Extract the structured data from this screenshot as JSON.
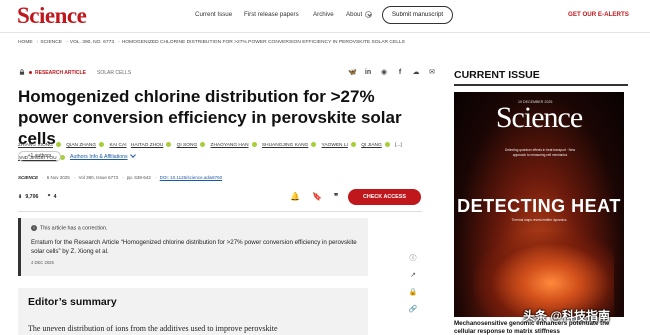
{
  "header": {
    "logo": "Science",
    "nav": [
      "Current Issue",
      "First release papers",
      "Archive",
      "About"
    ],
    "submit": "Submit manuscript",
    "alerts": "GET OUR E-ALERTS"
  },
  "breadcrumb": [
    "HOME",
    "SCIENCE",
    "VOL. 390, NO. 6773",
    "HOMOGENIZED CHLORINE DISTRIBUTION FOR >27% POWER CONVERSION EFFICIENCY IN PEROVSKITE SOLAR CELLS"
  ],
  "article": {
    "type": "RESEARCH ARTICLE",
    "subject": "SOLAR CELLS",
    "title": "Homogenized chlorine distribution for >27% power conversion efficiency in perovskite solar cells",
    "authors": [
      "ZHIANG XIONG",
      "QIAN ZHANG",
      "KAI CAI",
      "HAITAO ZHOU",
      "QI SONG",
      "ZHAOYANG HAN",
      "SHUANGJING KANG",
      "YAOWEN LI",
      "QI JIANG",
      "[...]",
      "AND JINGBI YOU"
    ],
    "more_authors": "+1 authors",
    "affiliations": "Authors Info & Affiliations",
    "journal": "SCIENCE",
    "date": "6 Nov 2025",
    "volume": "Vol 390, Issue 6773",
    "pages": "pp. 638-642",
    "doi": "DOI: 10.1126/science.adw8760",
    "downloads": "9,706",
    "citations": "4",
    "check_access": "CHECK ACCESS"
  },
  "correction": {
    "note": "This article has a correction.",
    "title": "Erratum for the Research Article “Homogenized chlorine distribution for >27% power conversion efficiency in perovskite solar cells” by Z. Xiong et al.",
    "date": "4 DEC 2025"
  },
  "summary": {
    "heading": "Editor’s summary",
    "text": "The uneven distribution of ions from the additives used to improve perovskite"
  },
  "sidebar": {
    "heading": "CURRENT ISSUE",
    "cover_logo": "Science",
    "cover_vol": "19 DECEMBER 2025",
    "cover_teaser": "Detecting quantum effects in heat transport  ·  New approach to measuring cell mechanics",
    "cover_headline": "DETECTING HEAT",
    "cover_sub": "Thermal maps reveal emitter dynamics",
    "caption": "Mechanosensitive genomic enhancers potentiate the cellular response to matrix stiffness"
  },
  "watermark": "头条 @科技指南"
}
